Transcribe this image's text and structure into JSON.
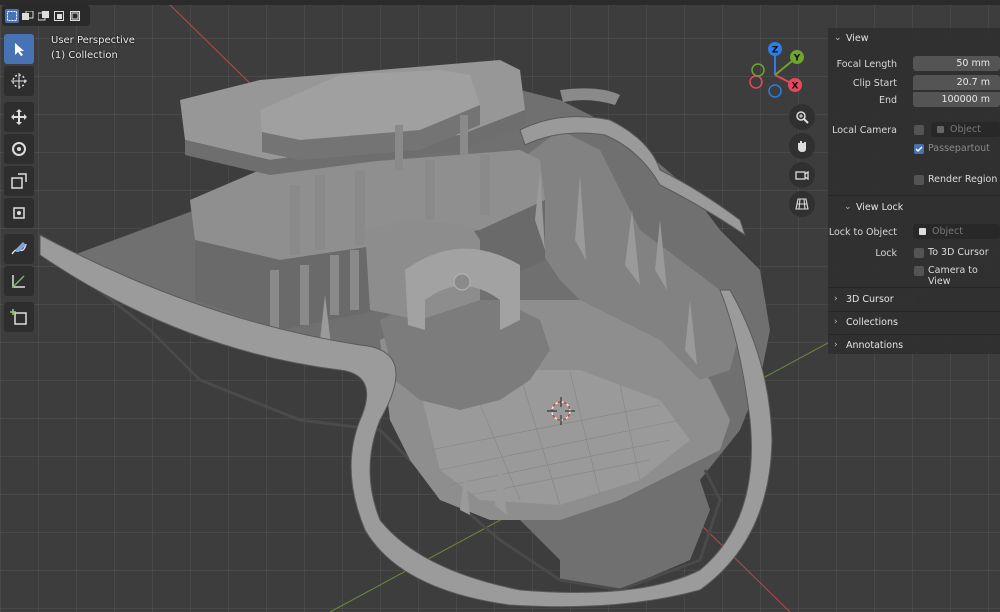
{
  "overlay": {
    "view_name": "User Perspective",
    "collection": "(1) Collection"
  },
  "toolbar": {
    "tools": [
      "select-box",
      "cursor",
      "move",
      "rotate",
      "scale",
      "transform",
      "annotate",
      "measure",
      "add-cube"
    ],
    "active_tool": "select-box"
  },
  "gizmo": {
    "axes": [
      {
        "label": "Z",
        "color": "#2b7de9"
      },
      {
        "label": "Y",
        "color": "#6fa52b"
      },
      {
        "label": "X",
        "color": "#e8475d"
      }
    ]
  },
  "nav_buttons": [
    "zoom-icon",
    "hand-icon",
    "camera-icon",
    "grid-icon"
  ],
  "sidebar": {
    "view_panel": {
      "title": "View",
      "focal_length_label": "Focal Length",
      "focal_length_value": "50 mm",
      "clip_start_label": "Clip Start",
      "clip_start_value": "20.7 m",
      "end_label": "End",
      "end_value": "100000 m",
      "local_camera_label": "Local Camera",
      "local_camera_placeholder": "Object",
      "passepartout_label": "Passepartout",
      "passepartout_checked": true,
      "render_region_label": "Render Region",
      "render_region_checked": false
    },
    "view_lock_panel": {
      "title": "View Lock",
      "lock_to_object_label": "Lock to Object",
      "lock_to_object_placeholder": "Object",
      "lock_label": "Lock",
      "to_3d_cursor_label": "To 3D Cursor",
      "to_3d_cursor_checked": false,
      "camera_to_view_label": "Camera to View",
      "camera_to_view_checked": false
    },
    "collapsed_panels": [
      "3D Cursor",
      "Collections",
      "Annotations"
    ]
  },
  "colors": {
    "accent": "#4772b3",
    "viewport_bg": "#3d3d3d",
    "panel_bg": "#303030",
    "x_axis_line": "#b84a4a",
    "y_axis_line": "#7a9a3a"
  }
}
